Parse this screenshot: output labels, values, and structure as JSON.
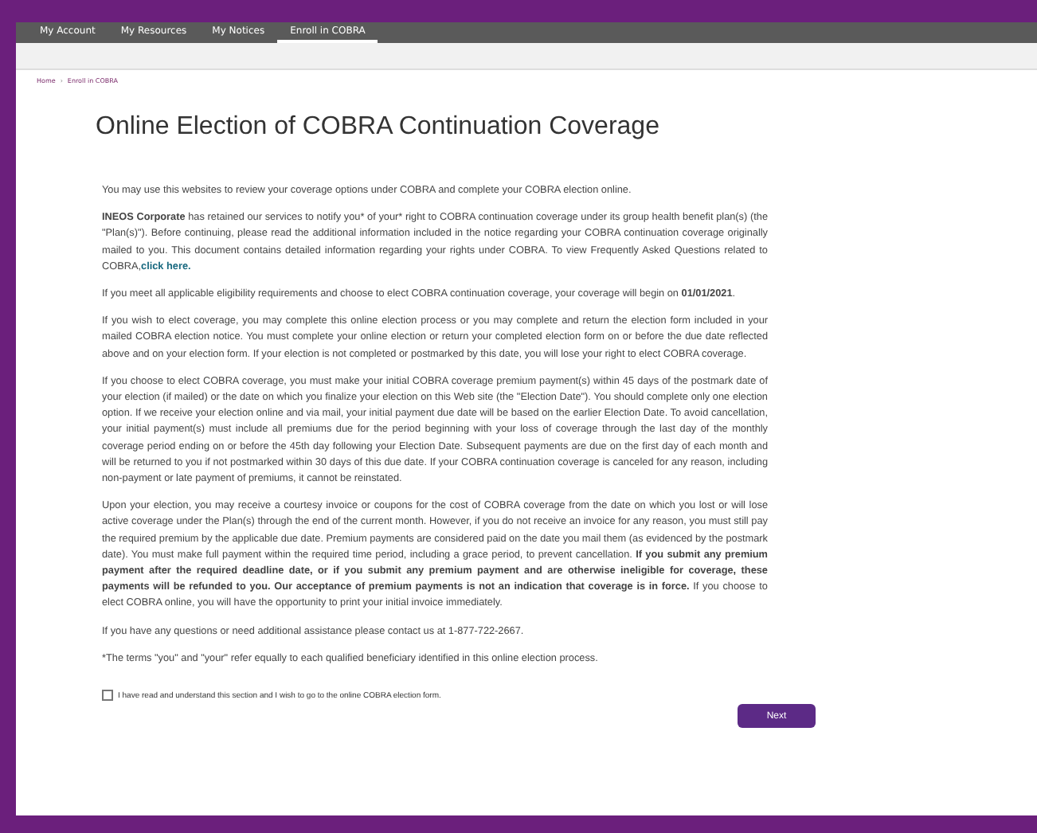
{
  "nav": [
    {
      "label": "My Account",
      "selected": false
    },
    {
      "label": "My Resources",
      "selected": false
    },
    {
      "label": "My Notices",
      "selected": false
    },
    {
      "label": "Enroll in COBRA",
      "selected": true
    }
  ],
  "breadcrumb": [
    {
      "label": "Home"
    },
    {
      "label": "Enroll in COBRA"
    }
  ],
  "breadcrumb_separator": "›",
  "title": "Online Election of COBRA Continuation Coverage",
  "paragraphs": [
    {
      "text": "You may use this websites to review your coverage options under COBRA and complete your COBRA election online."
    },
    {
      "text": "**INEOS Corporate** has retained our services to notify you* of your* right to COBRA continuation coverage under its group health benefit plan(s) (the \"Plan(s)\"). Before continuing, please read the additional information included in the notice regarding your COBRA continuation coverage originally mailed to you. This document contains detailed information regarding your rights under COBRA. To view Frequently Asked Questions related to COBRA,",
      "link": "click here."
    },
    {
      "text": "If you meet all applicable eligibility requirements and choose to elect COBRA continuation coverage, your coverage will begin on **01/01/2021**."
    },
    {
      "text": "If you wish to elect coverage, you may complete this online election process or you may complete and return the election form included in your mailed COBRA election notice. You must complete your online election or return your completed election form on or before the due date reflected above and on your election form. If your election is not completed or postmarked by this date, you will lose your right to elect COBRA coverage."
    },
    {
      "text": "If you choose to elect COBRA coverage, you must make your initial COBRA coverage premium payment(s) within 45 days of the postmark date of your election (if mailed) or the date on which you finalize your election on this Web site (the \"Election Date\"). You should complete only one election option. If we receive your election online and via mail, your initial payment due date will be based on the earlier Election Date. To avoid cancellation, your initial payment(s) must include all premiums due for the period beginning with your loss of coverage through the last day of the monthly coverage period ending on or before the 45th day following your Election Date. Subsequent payments are due on the first day of each month and will be returned to you if not postmarked within 30 days of this due date. If your COBRA continuation coverage is canceled for any reason, including non-payment or late payment of premiums, it cannot be reinstated."
    },
    {
      "text": "Upon your election, you may receive a courtesy invoice or coupons for the cost of COBRA coverage from the date on which you lost or will lose active coverage under the Plan(s) through the end of the current month. However, if you do not receive an invoice for any reason, you must still pay the required premium by the applicable due date. Premium payments are considered paid on the date you mail them (as evidenced by the postmark date). You must make full payment within the required time period, including a grace period, to prevent cancellation. **If you submit any premium payment after the required deadline date, or if you submit any premium payment and are otherwise ineligible for coverage, these payments will be refunded to you. Our acceptance of premium payments is not an indication that coverage is in force.** If you choose to elect COBRA online, you will have the opportunity to print your initial invoice immediately."
    },
    {
      "text": "If you have any questions or need additional assistance please contact us at 1-877-722-2667."
    },
    {
      "text": "*The terms \"you\" and \"your\" refer equally to each qualified beneficiary identified in this online election process."
    }
  ],
  "agreement": {
    "label": "I have read and understand this section and I wish to go to the online COBRA election form.",
    "checked": false
  },
  "next_button": "Next"
}
